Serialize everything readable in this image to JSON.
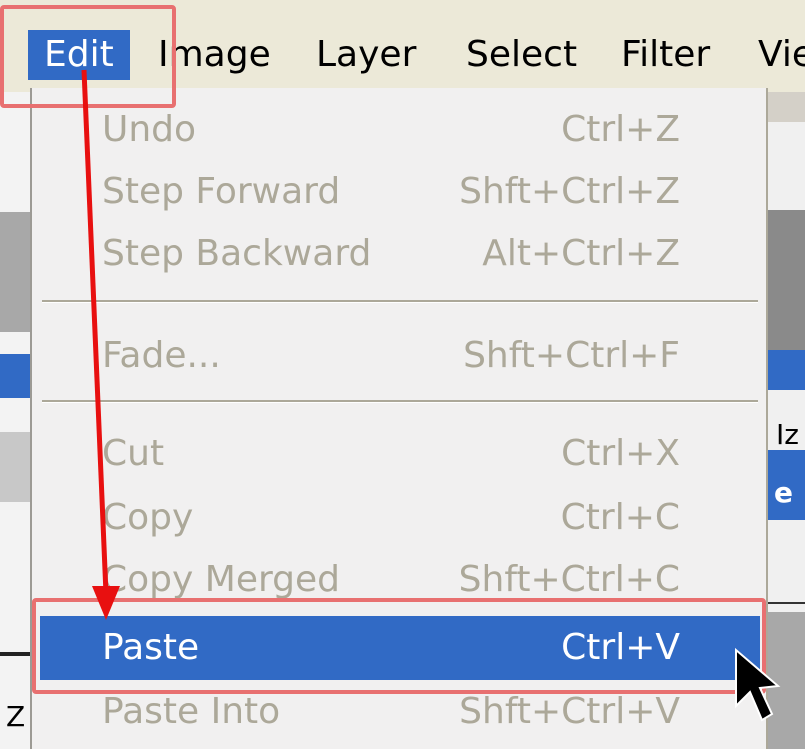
{
  "menubar": {
    "items": [
      {
        "label": "Edit",
        "active": true
      },
      {
        "label": "Image"
      },
      {
        "label": "Layer"
      },
      {
        "label": "Select"
      },
      {
        "label": "Filter"
      },
      {
        "label": "Vie"
      }
    ]
  },
  "menu": {
    "items": [
      {
        "label": "Undo",
        "shortcut": "Ctrl+Z",
        "enabled": false
      },
      {
        "label": "Step Forward",
        "shortcut": "Shft+Ctrl+Z",
        "enabled": false
      },
      {
        "label": "Step Backward",
        "shortcut": "Alt+Ctrl+Z",
        "enabled": false
      },
      {
        "label": "Fade...",
        "shortcut": "Shft+Ctrl+F",
        "enabled": false
      },
      {
        "label": "Cut",
        "shortcut": "Ctrl+X",
        "enabled": false
      },
      {
        "label": "Copy",
        "shortcut": "Ctrl+C",
        "enabled": false
      },
      {
        "label": "Copy Merged",
        "shortcut": "Shft+Ctrl+C",
        "enabled": false
      },
      {
        "label": "Paste",
        "shortcut": "Ctrl+V",
        "enabled": true,
        "highlighted": true
      },
      {
        "label": "Paste Into",
        "shortcut": "Shft+Ctrl+V",
        "enabled": false
      }
    ]
  },
  "background": {
    "fragments": [
      "Iz",
      "e",
      "Z"
    ]
  },
  "colors": {
    "highlight": "#316ac5",
    "annotation": "#e81010",
    "disabled_text": "#aca899"
  }
}
